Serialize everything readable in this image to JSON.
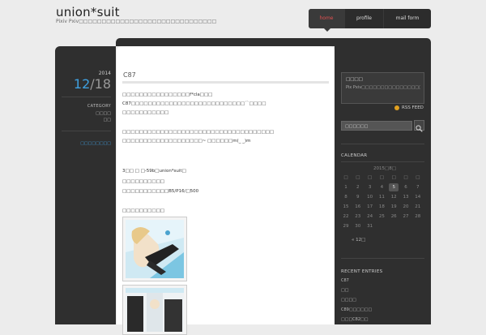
{
  "site": {
    "title": "union*suit",
    "description": "Pixiv Pxiv□□□□□□□□□□□□□□□□□□□□□□□□□□□□□□"
  },
  "nav": {
    "items": [
      {
        "label": "home"
      },
      {
        "label": "profile"
      },
      {
        "label": "mail form"
      }
    ]
  },
  "post_meta": {
    "year": "2014",
    "month": "12",
    "day": "/18",
    "category_heading": "CATEGORY",
    "categories": [
      "□□□□",
      "□□"
    ],
    "link": "□□□□□□□□"
  },
  "post": {
    "title": "C87",
    "lines": [
      "□□□□□□□□□□□□□□□□f*cla□□□",
      "C87□□□□□□□□□□□□□□□□□□□□□□□□□□□´`□□□□",
      "□□□□□□□□□□□",
      "",
      "□□□□□□□□□□□□□□□□□□□□□□□□□□□□□□□□□□□□",
      "□□□□□□□□□□□□□□□□□□□~ □□□□□□m(_ _)m",
      "",
      "",
      "3□□ □ □-59b□union*suit□",
      "□□□□□□□□□□",
      "□□□□□□□□□□□B5/P16/□500",
      "",
      "□□□□□□□□□□"
    ]
  },
  "sidebar": {
    "about_title": "□□□□",
    "about_text": "Pix  Pxiv□□□□□□□□□□□□□□□□□□□□□□□□□□□□□□□",
    "rss_label": "RSS FEED",
    "search_value": "□□□□□□",
    "calendar_heading": "CALENDAR",
    "calendar_caption": "2015□8□",
    "calendar_weekdays": [
      "□",
      "□",
      "□",
      "□",
      "□",
      "□",
      "□"
    ],
    "calendar_weeks": [
      [
        "1",
        "2",
        "3",
        "4",
        "5",
        "6",
        "7"
      ],
      [
        "8",
        "9",
        "10",
        "11",
        "12",
        "13",
        "14"
      ],
      [
        "15",
        "16",
        "17",
        "18",
        "19",
        "20",
        "21"
      ],
      [
        "22",
        "23",
        "24",
        "25",
        "26",
        "27",
        "28"
      ],
      [
        "29",
        "30",
        "31",
        "",
        "",
        "",
        ""
      ]
    ],
    "calendar_today": "5",
    "calendar_prev": "« 12□",
    "recent_heading": "RECENT ENTRIES",
    "recent_entries": [
      "C87",
      "□□",
      "□□□□",
      "C89□□□□□□",
      "□□□C82□□"
    ]
  },
  "colors": {
    "accent_blue": "#3fa0e0",
    "nav_active": "#e05050",
    "panel_dark": "#2f2f2f"
  }
}
